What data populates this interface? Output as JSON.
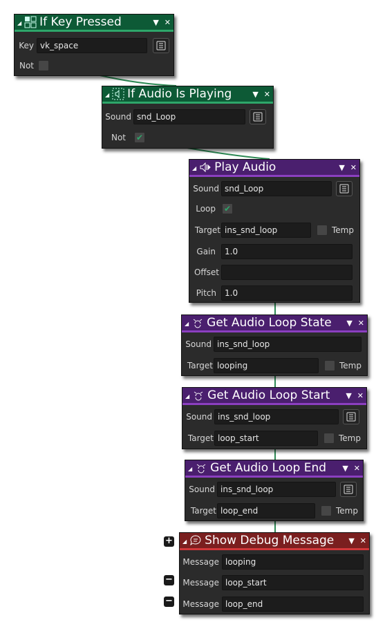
{
  "blocks": {
    "if_key_pressed": {
      "title": "If Key Pressed",
      "icon": "key-grid-icon",
      "fields": {
        "key_label": "Key",
        "key_value": "vk_space",
        "not_label": "Not",
        "not_checked": false
      }
    },
    "if_audio_is_playing": {
      "title": "If Audio Is Playing",
      "icon": "audio-query-icon",
      "fields": {
        "sound_label": "Sound",
        "sound_value": "snd_Loop",
        "not_label": "Not",
        "not_checked": true
      }
    },
    "play_audio": {
      "title": "Play Audio",
      "icon": "speaker-icon",
      "fields": {
        "sound_label": "Sound",
        "sound_value": "snd_Loop",
        "loop_label": "Loop",
        "loop_checked": true,
        "target_label": "Target",
        "target_value": "ins_snd_loop",
        "temp_label": "Temp",
        "temp_checked": false,
        "gain_label": "Gain",
        "gain_value": "1.0",
        "offset_label": "Offset",
        "offset_value": "",
        "pitch_label": "Pitch",
        "pitch_value": "1.0"
      }
    },
    "get_loop_state": {
      "title": "Get Audio Loop State",
      "icon": "audio-loop-icon",
      "fields": {
        "sound_label": "Sound",
        "sound_value": "ins_snd_loop",
        "target_label": "Target",
        "target_value": "looping",
        "temp_label": "Temp",
        "temp_checked": false
      }
    },
    "get_loop_start": {
      "title": "Get Audio Loop Start",
      "icon": "audio-loop-icon",
      "fields": {
        "sound_label": "Sound",
        "sound_value": "ins_snd_loop",
        "target_label": "Target",
        "target_value": "loop_start",
        "temp_label": "Temp",
        "temp_checked": false
      }
    },
    "get_loop_end": {
      "title": "Get Audio Loop End",
      "icon": "audio-loop-icon",
      "fields": {
        "sound_label": "Sound",
        "sound_value": "ins_snd_loop",
        "target_label": "Target",
        "target_value": "loop_end",
        "temp_label": "Temp",
        "temp_checked": false
      }
    },
    "show_debug": {
      "title": "Show Debug Message",
      "icon": "speech-bubble-icon",
      "messages": [
        {
          "label": "Message",
          "value": "looping"
        },
        {
          "label": "Message",
          "value": "loop_start"
        },
        {
          "label": "Message",
          "value": "loop_end"
        }
      ]
    }
  },
  "colors": {
    "green_header": "#0d5a36",
    "purple_header": "#4a1f6e",
    "red_header": "#7a1f1f",
    "wire": "#2ea66a",
    "check": "#2ea66a"
  }
}
